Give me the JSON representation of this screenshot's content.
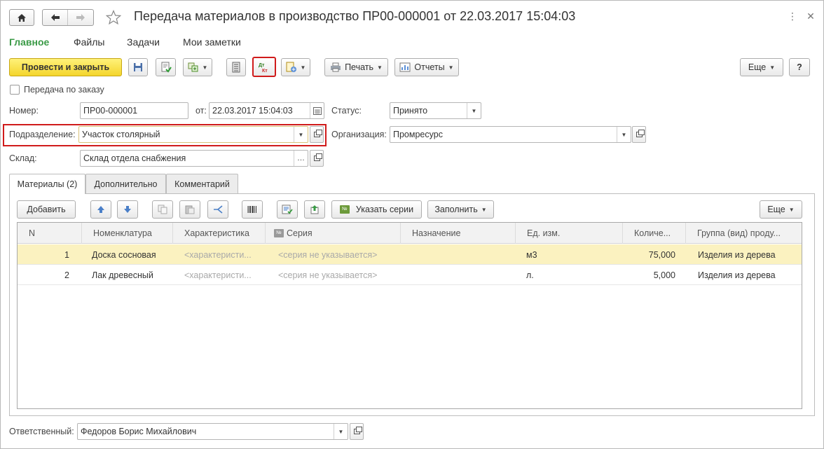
{
  "title": "Передача материалов в производство ПР00-000001 от 22.03.2017 15:04:03",
  "sections": [
    "Главное",
    "Файлы",
    "Задачи",
    "Мои заметки"
  ],
  "toolbar": {
    "post_close": "Провести и закрыть",
    "print": "Печать",
    "reports": "Отчеты",
    "more": "Еще",
    "help": "?"
  },
  "form": {
    "by_order_label": "Передача по заказу",
    "number_label": "Номер:",
    "number_value": "ПР00-000001",
    "from_label": "от:",
    "date_value": "22.03.2017 15:04:03",
    "status_label": "Статус:",
    "status_value": "Принято",
    "division_label": "Подразделение:",
    "division_value": "Участок столярный",
    "org_label": "Организация:",
    "org_value": "Промресурс",
    "warehouse_label": "Склад:",
    "warehouse_value": "Склад отдела снабжения",
    "responsible_label": "Ответственный:",
    "responsible_value": "Федоров Борис Михайлович"
  },
  "tabs": [
    "Материалы (2)",
    "Дополнительно",
    "Комментарий"
  ],
  "table_toolbar": {
    "add": "Добавить",
    "series": "Указать серии",
    "fill": "Заполнить",
    "more": "Еще"
  },
  "table": {
    "headers": [
      "N",
      "Номенклатура",
      "Характеристика",
      "Серия",
      "Назначение",
      "Ед. изм.",
      "Количе...",
      "Группа (вид) проду..."
    ],
    "rows": [
      {
        "n": "1",
        "item": "Доска сосновая",
        "char": "<характеристи...",
        "series": "<серия не указывается>",
        "purpose": "",
        "unit": "м3",
        "qty": "75,000",
        "group": "Изделия из дерева"
      },
      {
        "n": "2",
        "item": "Лак древесный",
        "char": "<характеристи...",
        "series": "<серия не указывается>",
        "purpose": "",
        "unit": "л.",
        "qty": "5,000",
        "group": "Изделия из дерева"
      }
    ]
  },
  "colors": {
    "accent_green": "#3a9a46",
    "primary_yellow": "#f4d52c",
    "highlight_red": "#d01b1b",
    "selected_row": "#fbf2c0"
  }
}
